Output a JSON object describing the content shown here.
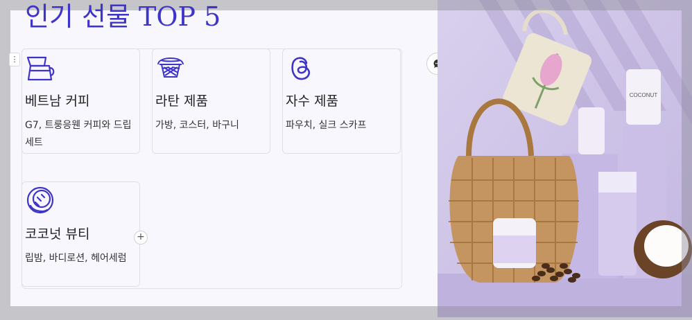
{
  "title": "인기 선물 TOP 5",
  "cards": [
    {
      "icon": "coffee-filter-icon",
      "title": "베트남 커피",
      "desc": "G7, 트룽응웬 커피와 드립세트"
    },
    {
      "icon": "basket-icon",
      "title": "라탄 제품",
      "desc": "가방, 코스터, 바구니"
    },
    {
      "icon": "threads-icon",
      "title": "자수 제품",
      "desc": "파우치, 실크 스카프"
    },
    {
      "icon": "coconut-icon",
      "title": "코코넛 뷰티",
      "desc": "립밤, 바디로션, 헤어세럼"
    }
  ],
  "photo": {
    "brand_text": "COCONUT"
  },
  "controls": {
    "drag_handle": "⋮",
    "add": "+"
  },
  "colors": {
    "accent": "#3f34c8",
    "photo_bg": "#c9bfe3"
  }
}
